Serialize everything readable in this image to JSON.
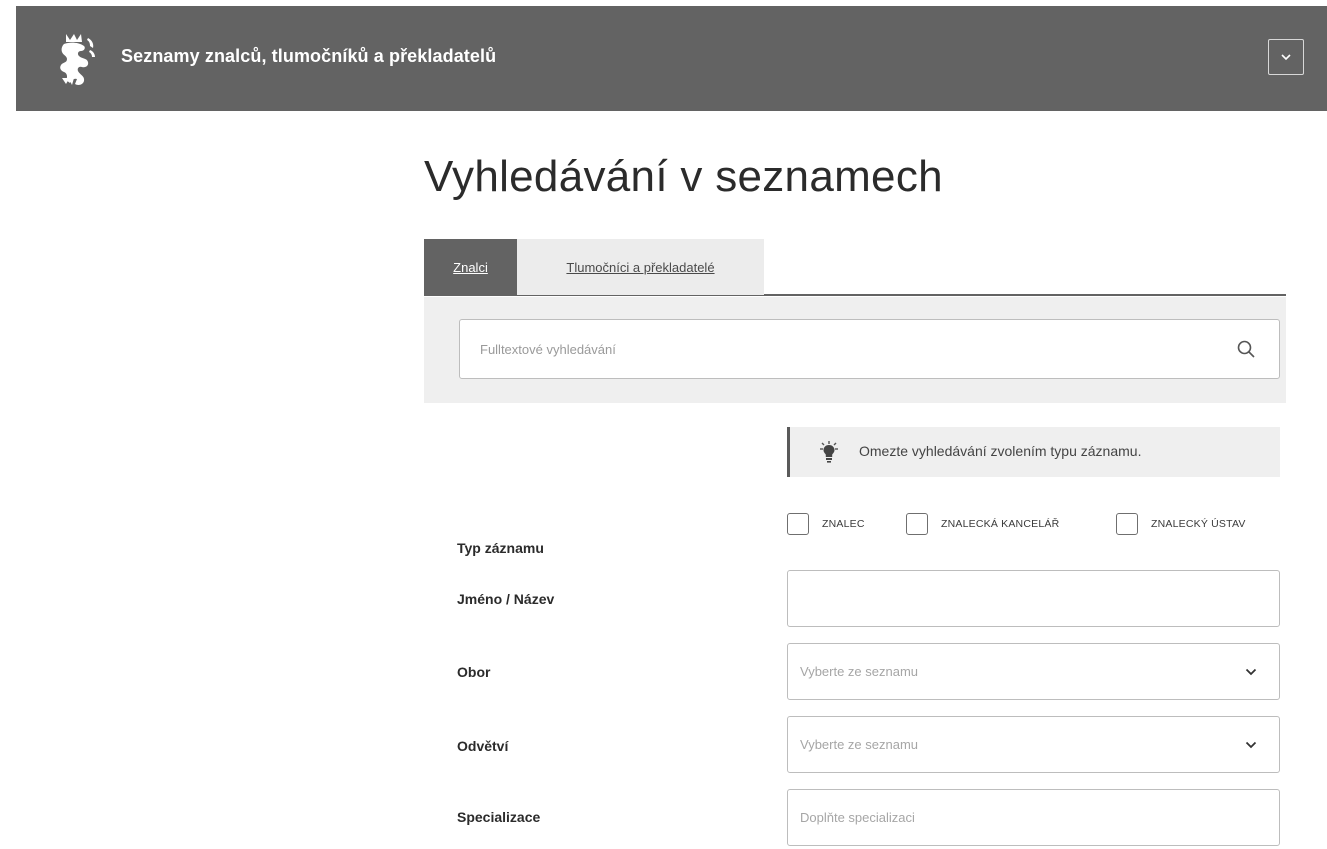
{
  "header": {
    "title": "Seznamy znalců, tlumočníků a překladatelů",
    "logo_icon": "czech-lion-emblem",
    "menu_icon": "chevron-down-icon",
    "background": "#636363"
  },
  "page": {
    "title": "Vyhledávání v seznamech"
  },
  "tabs": [
    {
      "label": "Znalci",
      "active": true
    },
    {
      "label": "Tlumočníci a překladatelé",
      "active": false
    }
  ],
  "search": {
    "placeholder": "Fulltextové vyhledávání",
    "value": "",
    "icon": "search-icon"
  },
  "hint": {
    "icon": "lightbulb-icon",
    "text": "Omezte vyhledávání zvolením typu záznamu."
  },
  "form": {
    "type_label": "Typ záznamu",
    "type_options": [
      {
        "label": "ZNALEC",
        "checked": false
      },
      {
        "label": "ZNALECKÁ KANCELÁŘ",
        "checked": false
      },
      {
        "label": "ZNALECKÝ ÚSTAV",
        "checked": false
      }
    ],
    "name_label": "Jméno / Název",
    "name_value": "",
    "field_label": "Obor",
    "field_placeholder": "Vyberte ze seznamu",
    "branch_label": "Odvětví",
    "branch_placeholder": "Vyberte ze seznamu",
    "specialization_label": "Specializace",
    "specialization_placeholder": "Doplňte specializaci"
  }
}
